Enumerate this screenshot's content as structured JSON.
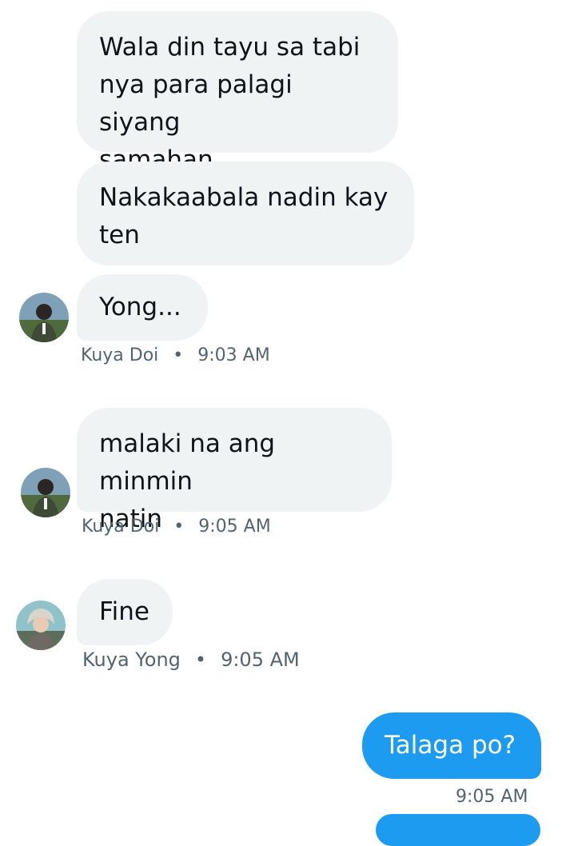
{
  "conversation": {
    "messages": [
      {
        "text": "Wala din tayu sa tabi\nnya para palagi siyang\nsamahan"
      },
      {
        "text": "Nakakaabala nadin kay\nten"
      },
      {
        "text": "Yong..."
      },
      {
        "text": "malaki na ang minmin\nnatin"
      },
      {
        "text": "Fine"
      },
      {
        "text": "Talaga po?"
      }
    ],
    "meta": [
      {
        "sender": "Kuya Doi",
        "separator": "•",
        "time": "9:03 AM"
      },
      {
        "sender": "Kuya Doi",
        "separator": "•",
        "time": "9:05 AM"
      },
      {
        "sender": "Kuya Yong",
        "separator": "•",
        "time": "9:05 AM"
      },
      {
        "time": "9:05 AM"
      }
    ]
  },
  "avatars": [
    {
      "icon": "user-avatar-kuya-doi"
    },
    {
      "icon": "user-avatar-kuya-doi"
    },
    {
      "icon": "user-avatar-kuya-yong"
    }
  ],
  "colors": {
    "received_bubble": "#eff3f4",
    "sent_bubble": "#1d9bf0",
    "meta_text": "#536471",
    "message_text": "#0f1419"
  }
}
